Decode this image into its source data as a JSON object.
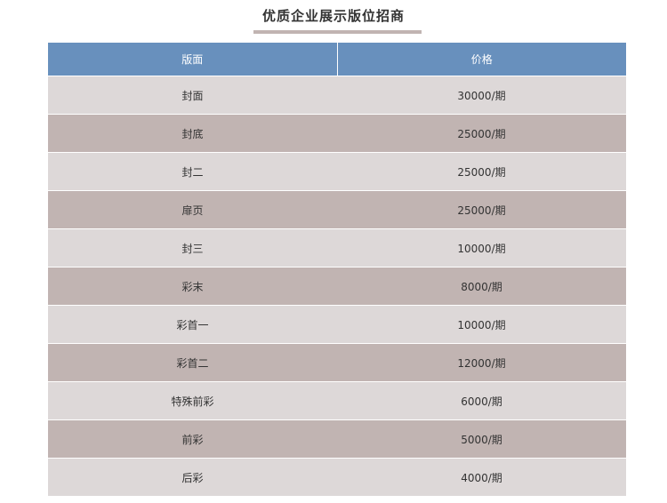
{
  "title": "优质企业展示版位招商",
  "colors": {
    "header_bg": "#6890bd",
    "row_light": "#ddd8d8",
    "row_dark": "#c1b4b2",
    "underline": "#c1b4b2"
  },
  "table": {
    "headers": [
      "版面",
      "价格"
    ],
    "rows": [
      {
        "position": "封面",
        "price": "30000/期"
      },
      {
        "position": "封底",
        "price": "25000/期"
      },
      {
        "position": "封二",
        "price": "25000/期"
      },
      {
        "position": "扉页",
        "price": "25000/期"
      },
      {
        "position": "封三",
        "price": "10000/期"
      },
      {
        "position": "彩末",
        "price": "8000/期"
      },
      {
        "position": "彩首一",
        "price": "10000/期"
      },
      {
        "position": "彩首二",
        "price": "12000/期"
      },
      {
        "position": "特殊前彩",
        "price": "6000/期"
      },
      {
        "position": "前彩",
        "price": "5000/期"
      },
      {
        "position": "后彩",
        "price": "4000/期"
      }
    ]
  }
}
